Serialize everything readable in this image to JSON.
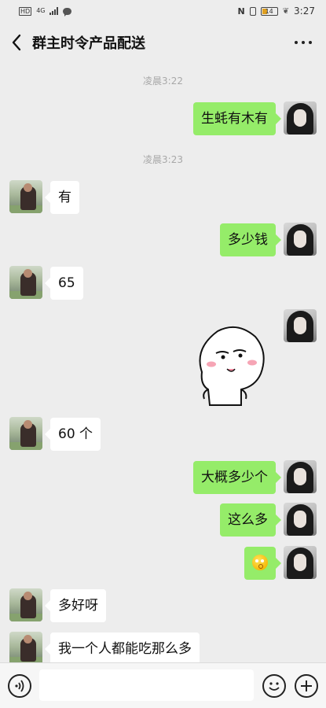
{
  "status_bar": {
    "hd": "HD",
    "network": "4G",
    "nfc": "N",
    "battery": "14",
    "time": "3:27"
  },
  "header": {
    "title": "群主时令产品配送"
  },
  "timestamps": [
    "凌晨3:22",
    "凌晨3:23"
  ],
  "messages": [
    {
      "side": "out",
      "text": "生蚝有木有"
    },
    {
      "side": "in",
      "text": "有"
    },
    {
      "side": "out",
      "text": "多少钱"
    },
    {
      "side": "in",
      "text": "65"
    },
    {
      "side": "out",
      "text": "",
      "sticker": "smirk-face-sticker"
    },
    {
      "side": "in",
      "text": "60 个"
    },
    {
      "side": "out",
      "text": "大概多少个"
    },
    {
      "side": "out",
      "text": "这么多"
    },
    {
      "side": "out",
      "text": "",
      "emoji": "flushed-emoji"
    },
    {
      "side": "in",
      "text": "多好呀"
    },
    {
      "side": "in",
      "text": "我一个人都能吃那么多"
    }
  ],
  "input_bar": {
    "placeholder": "",
    "voice_icon": "voice-icon",
    "emoji_icon": "emoji-icon",
    "plus_icon": "plus-icon"
  },
  "colors": {
    "background": "#ededed",
    "outgoing_bubble": "#95ec69",
    "incoming_bubble": "#ffffff",
    "timestamp": "#a8a8a8"
  }
}
